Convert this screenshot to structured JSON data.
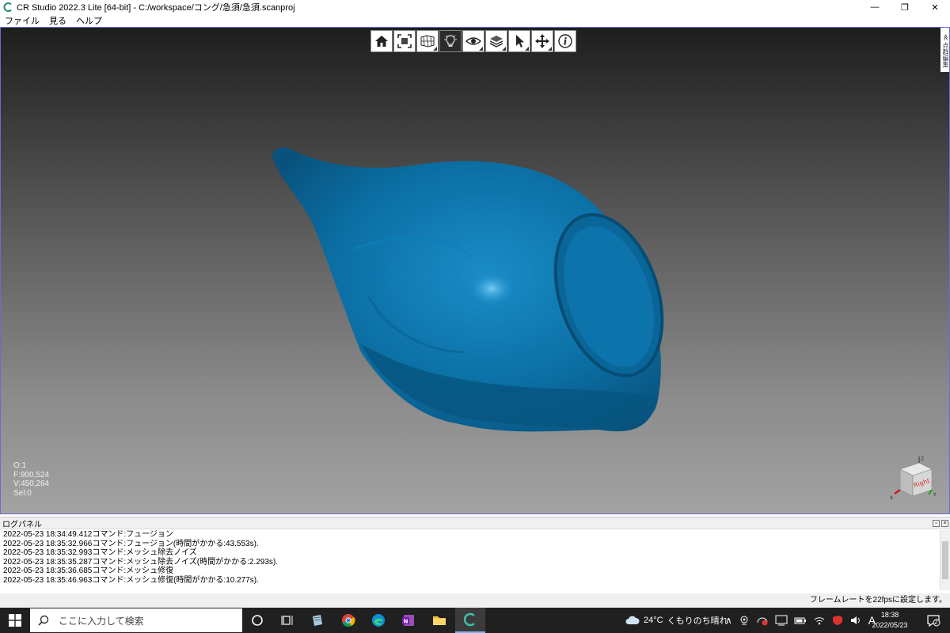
{
  "window": {
    "title": "CR Studio 2022.3 Lite [64-bit] - C:/workspace/コング/急須/急須.scanproj",
    "controls": [
      "—",
      "❐",
      "✕"
    ]
  },
  "menu": {
    "items": [
      {
        "label": "ファイル"
      },
      {
        "label": "見る"
      },
      {
        "label": "ヘルプ"
      }
    ]
  },
  "toolbar": {
    "buttons": [
      {
        "icon": "home-icon"
      },
      {
        "icon": "fit-view-icon"
      },
      {
        "icon": "render-mode-icon"
      },
      {
        "icon": "light-icon",
        "active": true
      },
      {
        "icon": "eye-icon"
      },
      {
        "icon": "layers-icon"
      },
      {
        "icon": "select-cursor-icon"
      },
      {
        "icon": "move-icon"
      },
      {
        "icon": "info-icon"
      }
    ]
  },
  "side_tab": {
    "label": "≪ 点群編集"
  },
  "viewport": {
    "background_top": "#1e1e1e",
    "background_bottom": "#a3a3a3",
    "mesh_color": "#0b6fa4",
    "stats": {
      "o": "O:1",
      "f": "F:900,524",
      "v": "V:450,264",
      "sel": "Sel:0"
    },
    "axis_cube": {
      "face_label": "Right",
      "x_label": "X",
      "y_label": "Y",
      "z_label": "Z"
    }
  },
  "log_panel": {
    "title": "ログパネル",
    "lines": [
      "2022-05-23 18:34:49.412コマンド:フュージョン",
      "2022-05-23 18:35:32.966コマンド:フュージョン(時間がかかる:43.553s).",
      "2022-05-23 18:35:32.993コマンド:メッシュ除去ノイズ",
      "2022-05-23 18:35:35.287コマンド:メッシュ除去ノイズ(時間がかかる:2.293s).",
      "2022-05-23 18:35:36.685コマンド:メッシュ修復",
      "2022-05-23 18:35:46.963コマンド:メッシュ修復(時間がかかる:10.277s)."
    ]
  },
  "status_bar": {
    "text": "フレームレートを22fpsに設定します。"
  },
  "taskbar": {
    "search_placeholder": "ここに入力して検索",
    "weather_temp": "24°C",
    "weather_text": "くもりのち晴れ",
    "ime_label": "A",
    "time": "18:38",
    "date": "2022/05/23",
    "notification_count": "2"
  }
}
